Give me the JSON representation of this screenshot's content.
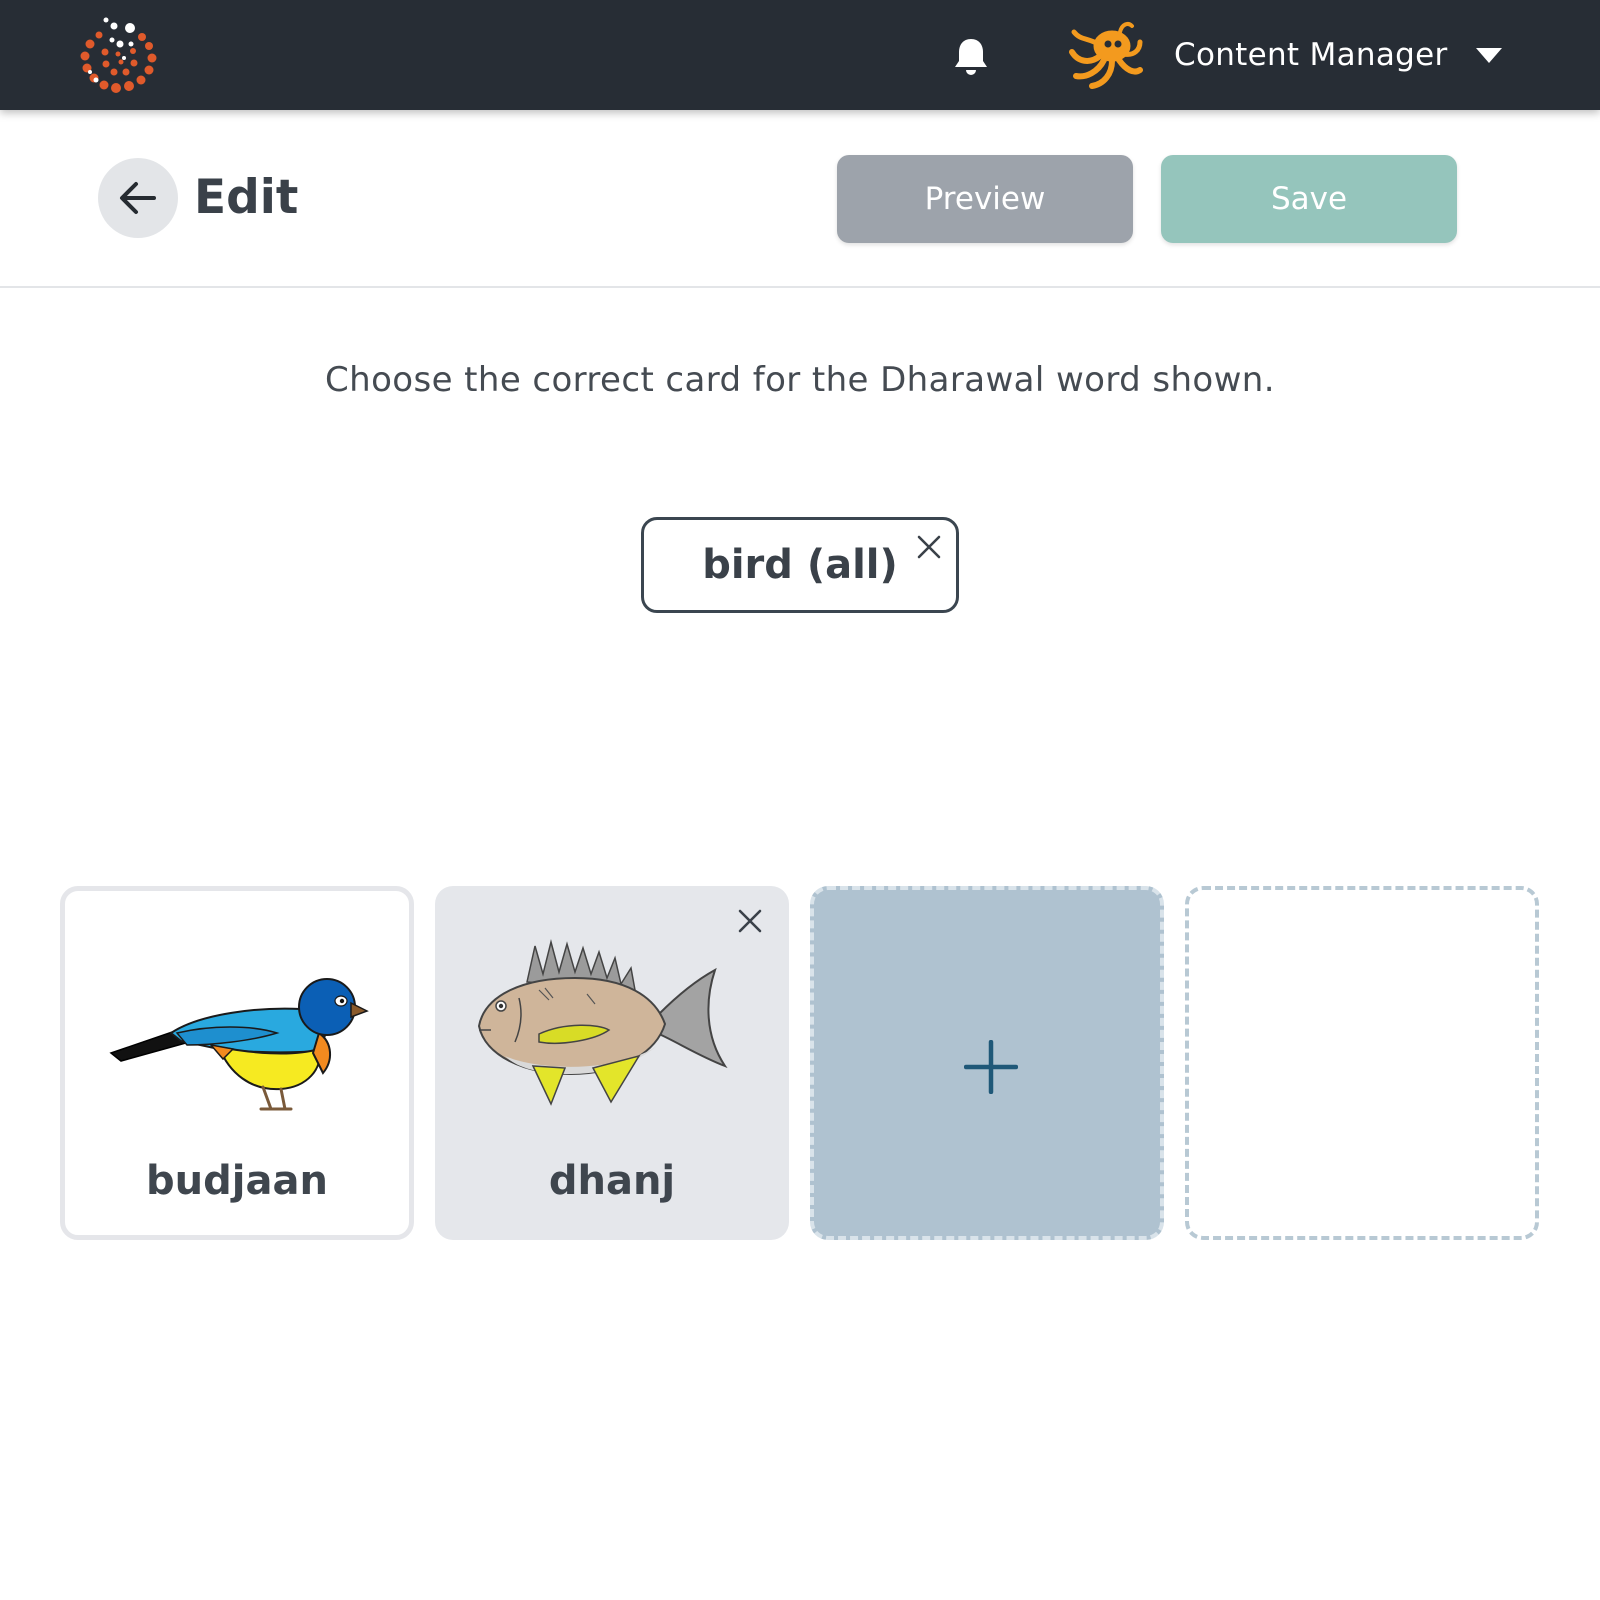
{
  "topbar": {
    "user_name": "Content Manager",
    "icons": {
      "logo": "spiral-dots-logo",
      "bell": "bell-icon",
      "avatar": "octopus-avatar",
      "caret": "caret-down-icon"
    },
    "colors": {
      "background": "#272d35",
      "logo_accent": "#e05a2b",
      "avatar_accent": "#f39a1e"
    }
  },
  "header": {
    "title": "Edit",
    "back_icon": "arrow-left-icon",
    "preview_label": "Preview",
    "save_label": "Save",
    "colors": {
      "preview": "#9da3ab",
      "save": "#95c5bc"
    }
  },
  "exercise": {
    "instruction": "Choose the correct card for the Dharawal word shown.",
    "word": "bird (all)"
  },
  "cards": [
    {
      "label": "budjaan",
      "image": "bird-illustration",
      "state": "selected"
    },
    {
      "label": "dhanj",
      "image": "fish-illustration",
      "state": "removable"
    },
    {
      "label": "",
      "image": "plus-icon",
      "state": "add"
    },
    {
      "label": "",
      "image": "",
      "state": "empty-slot"
    }
  ]
}
